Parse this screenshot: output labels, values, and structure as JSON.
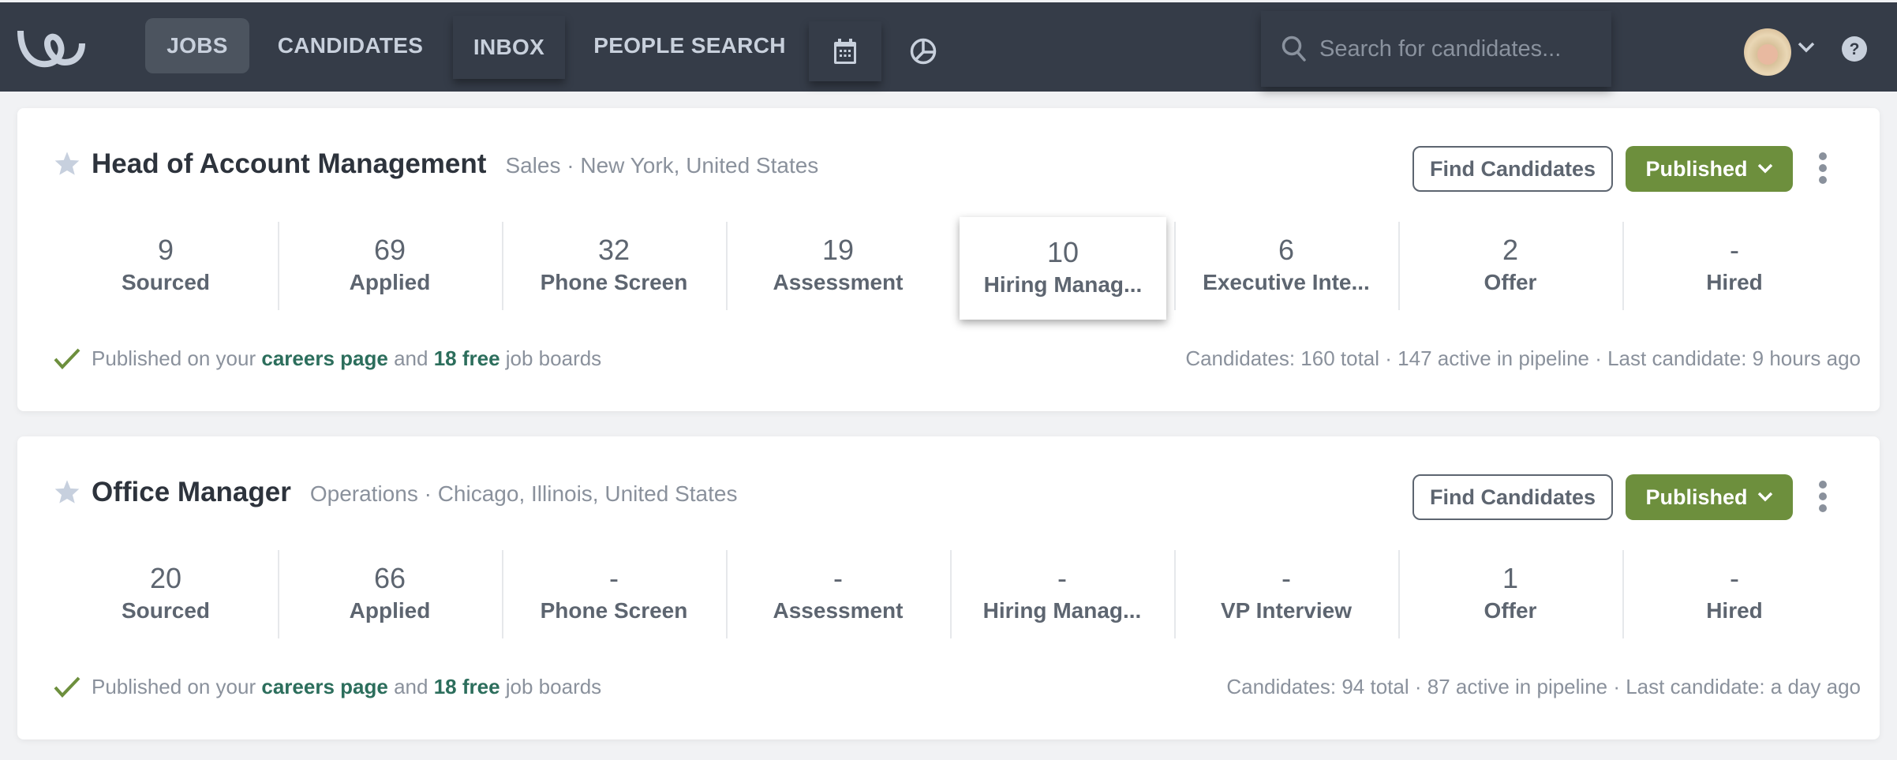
{
  "nav": {
    "logo": "workable-logo",
    "items": [
      {
        "label": "JOBS",
        "active": true
      },
      {
        "label": "CANDIDATES",
        "active": false
      },
      {
        "label": "INBOX",
        "active": false
      },
      {
        "label": "PEOPLE SEARCH",
        "active": false
      }
    ],
    "icons": [
      "calendar-icon",
      "reports-pie-icon"
    ],
    "search": {
      "placeholder": "Search for candidates...",
      "value": ""
    },
    "user": {
      "avatar": "user-avatar",
      "menu_icon": "chevron-down-icon"
    },
    "help_icon": "help-icon"
  },
  "colors": {
    "navbar": "#353c48",
    "published": "#6d8f3d",
    "link": "#2c6e5c",
    "check": "#6d8f3d"
  },
  "jobs": [
    {
      "title": "Head of Account Management",
      "meta": "Sales · New York, United States",
      "find_label": "Find Candidates",
      "status_label": "Published",
      "stages": [
        {
          "count": "9",
          "label": "Sourced"
        },
        {
          "count": "69",
          "label": "Applied"
        },
        {
          "count": "32",
          "label": "Phone Screen"
        },
        {
          "count": "19",
          "label": "Assessment"
        },
        {
          "count": "10",
          "label": "Hiring Manag..."
        },
        {
          "count": "6",
          "label": "Executive Inte..."
        },
        {
          "count": "2",
          "label": "Offer"
        },
        {
          "count": "-",
          "label": "Hired"
        }
      ],
      "footer": {
        "prefix": "Published on your",
        "link1": "careers page",
        "middle": "and",
        "link2": "18 free",
        "suffix": "job boards",
        "stats": "Candidates: 160 total · 147 active in pipeline · Last candidate: 9 hours ago"
      }
    },
    {
      "title": "Office Manager",
      "meta": "Operations · Chicago, Illinois, United States",
      "find_label": "Find Candidates",
      "status_label": "Published",
      "stages": [
        {
          "count": "20",
          "label": "Sourced"
        },
        {
          "count": "66",
          "label": "Applied"
        },
        {
          "count": "-",
          "label": "Phone Screen"
        },
        {
          "count": "-",
          "label": "Assessment"
        },
        {
          "count": "-",
          "label": "Hiring Manag..."
        },
        {
          "count": "-",
          "label": "VP Interview"
        },
        {
          "count": "1",
          "label": "Offer"
        },
        {
          "count": "-",
          "label": "Hired"
        }
      ],
      "footer": {
        "prefix": "Published on your",
        "link1": "careers page",
        "middle": "and",
        "link2": "18 free",
        "suffix": "job boards",
        "stats": "Candidates: 94 total · 87 active in pipeline · Last candidate: a day ago"
      }
    }
  ]
}
